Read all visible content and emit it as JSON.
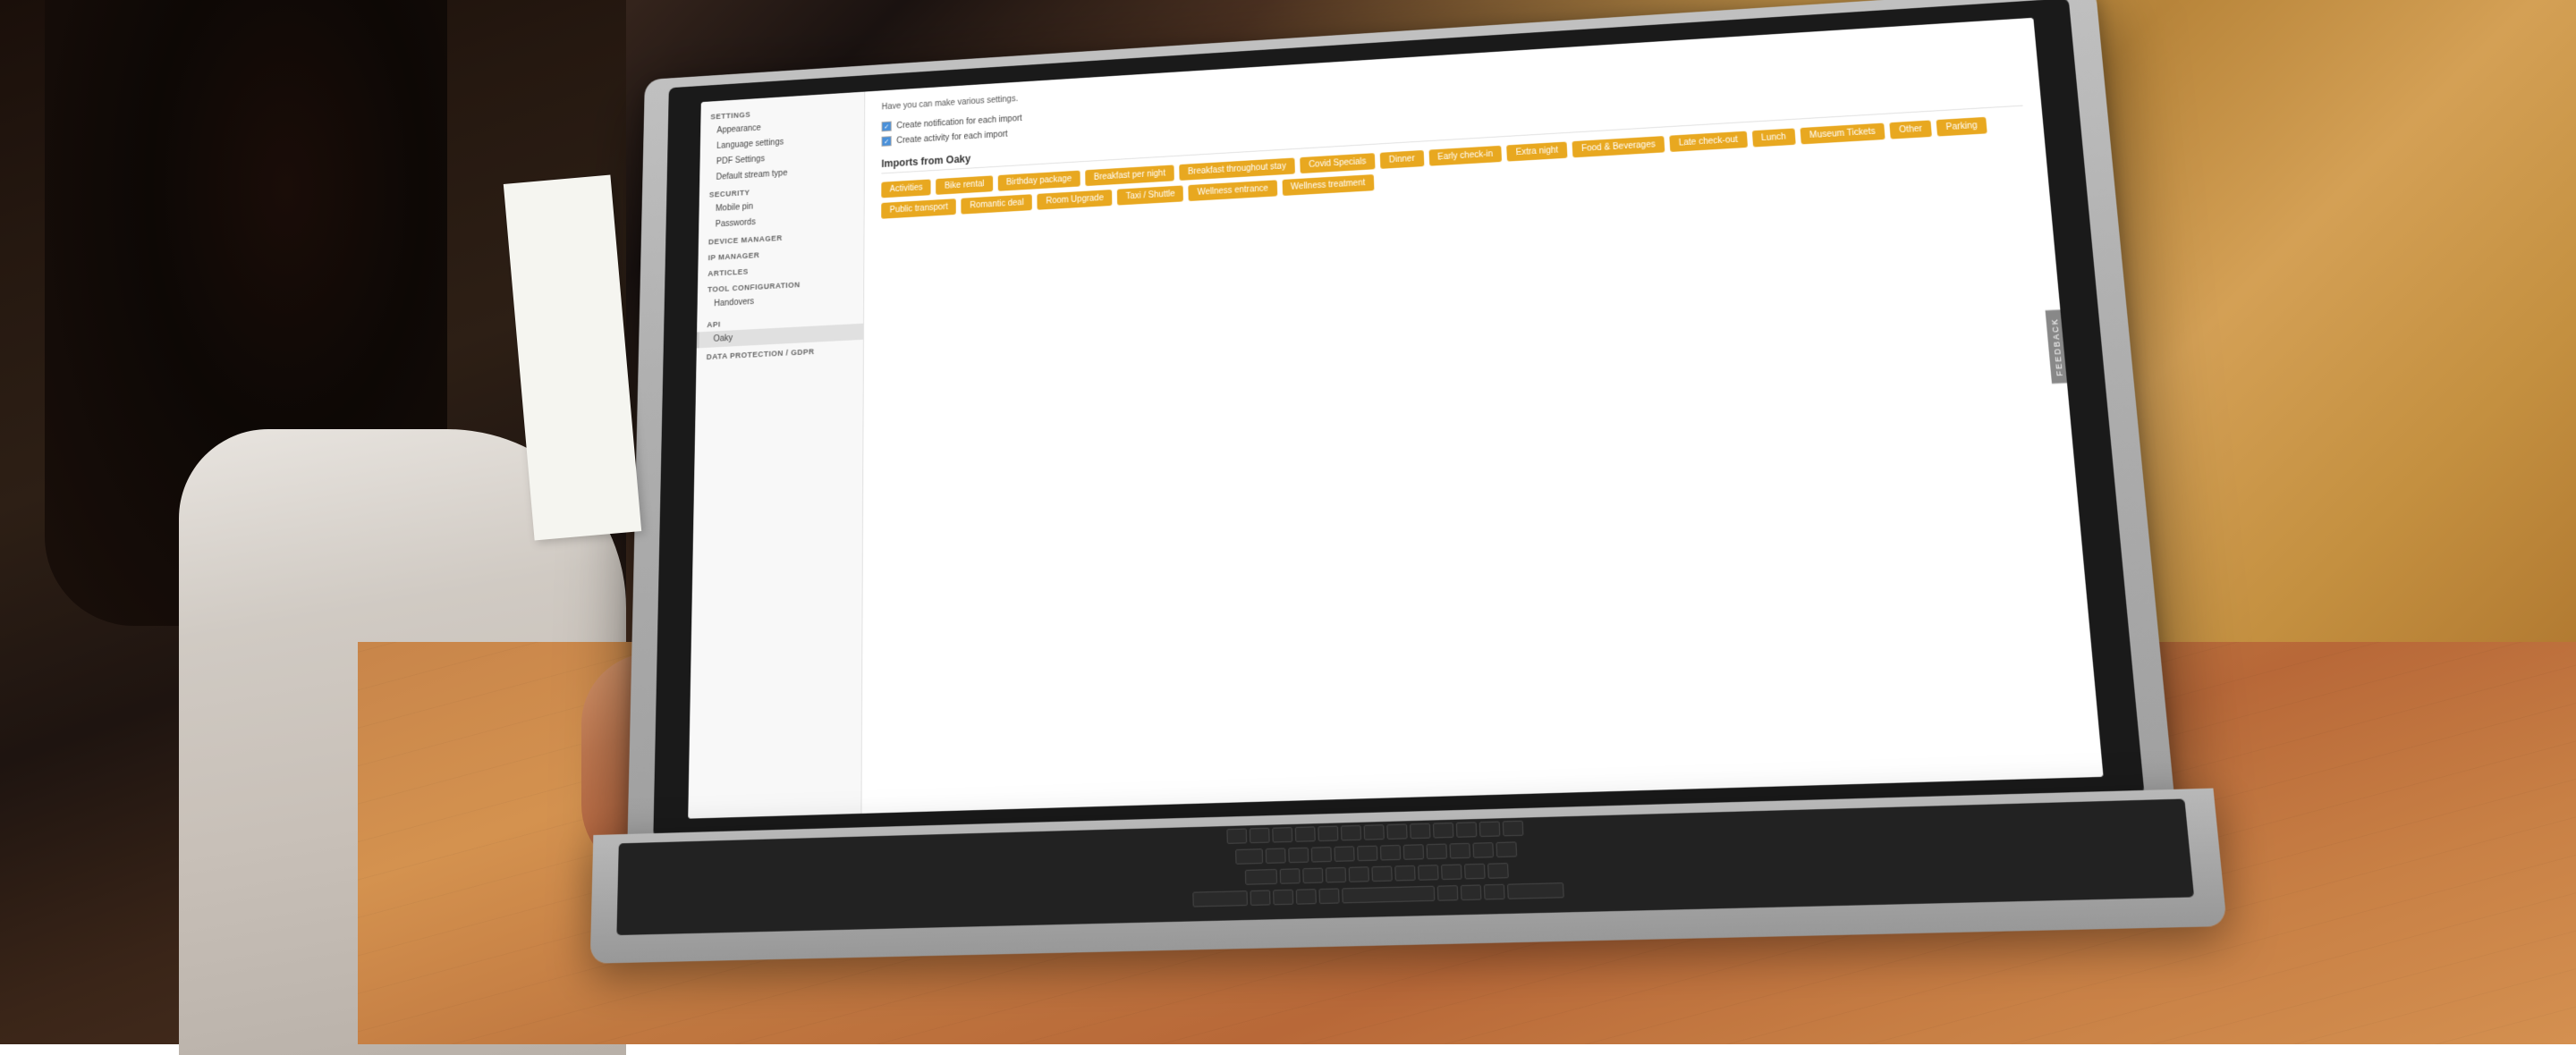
{
  "background": {
    "colors": {
      "table": "#c8854a",
      "person_dark": "#1a0f0a",
      "laptop_silver": "#b8b8b8"
    }
  },
  "sidebar": {
    "sections": [
      {
        "title": "SETTINGS",
        "items": [
          {
            "label": "Appearance",
            "active": false
          },
          {
            "label": "Language settings",
            "active": false
          },
          {
            "label": "PDF Settings",
            "active": false
          },
          {
            "label": "Default stream type",
            "active": false
          }
        ]
      },
      {
        "title": "SECURITY",
        "items": [
          {
            "label": "Mobile pin",
            "active": false
          },
          {
            "label": "Passwords",
            "active": false
          }
        ]
      },
      {
        "title": "DEVICE MANAGER",
        "items": []
      },
      {
        "title": "IP MANAGER",
        "items": []
      },
      {
        "title": "ARTICLES",
        "items": []
      },
      {
        "title": "TOOL CONFIGURATION",
        "items": [
          {
            "label": "Handovers",
            "active": false
          }
        ]
      },
      {
        "title": "API",
        "items": [
          {
            "label": "Oaky",
            "active": true
          }
        ]
      },
      {
        "title": "DATA PROTECTION / GDPR",
        "items": []
      }
    ]
  },
  "main": {
    "description": "Have you can make various settings.",
    "checkboxes": [
      {
        "label": "Create notification for each import",
        "checked": true
      },
      {
        "label": "Create activity for each import",
        "checked": true
      }
    ],
    "imports_section_title": "Imports from Oaky",
    "tags": [
      "Activities",
      "Bike rental",
      "Birthday package",
      "Breakfast per night",
      "Breakfast throughout stay",
      "Covid Specials",
      "Dinner",
      "Early check-in",
      "Extra night",
      "Food & Beverages",
      "Late check-out",
      "Lunch",
      "Museum Tickets",
      "Other",
      "Parking",
      "Public transport",
      "Romantic deal",
      "Room Upgrade",
      "Taxi / Shuttle",
      "Wellness entrance",
      "Wellness treatment"
    ]
  },
  "feedback": {
    "label": "FEEDBACK"
  }
}
